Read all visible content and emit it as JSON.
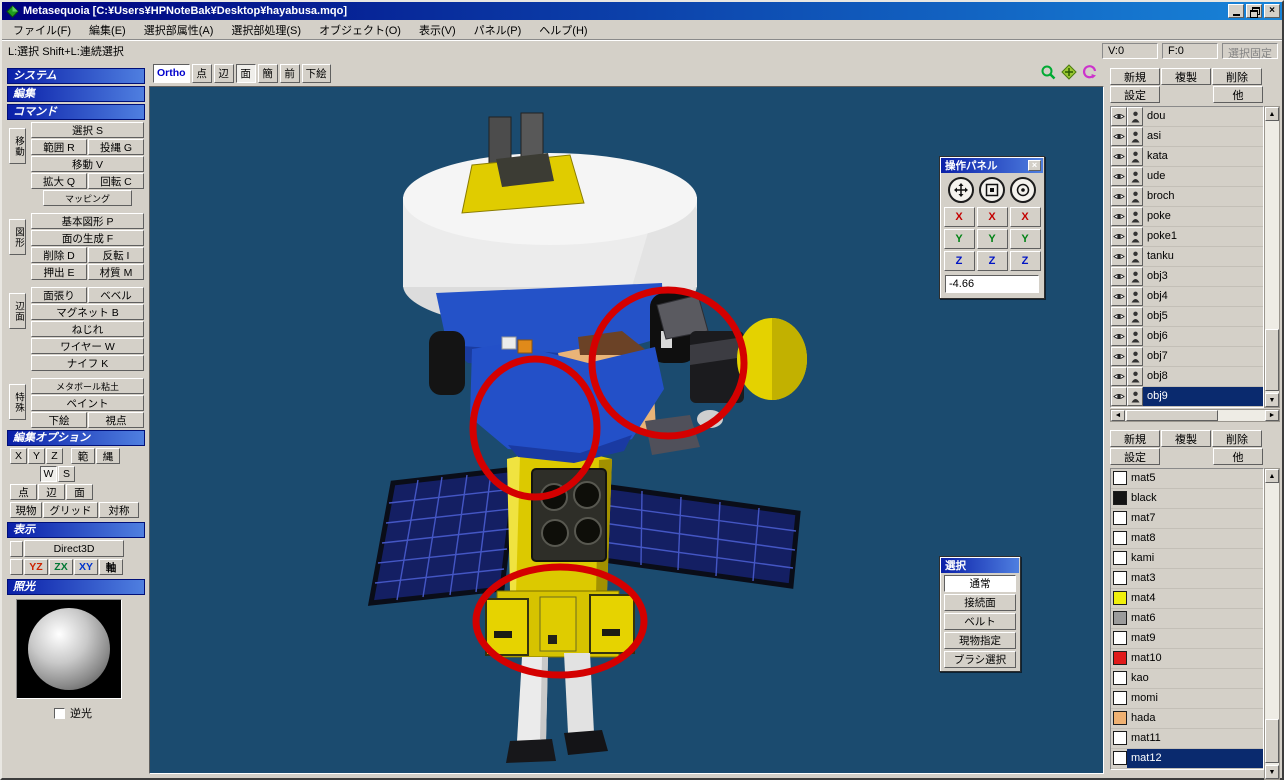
{
  "titlebar": {
    "title": "Metasequoia [C:¥Users¥HPNoteBak¥Desktop¥hayabusa.mqo]"
  },
  "menu": {
    "items": [
      {
        "label": "ファイル(F)"
      },
      {
        "label": "編集(E)"
      },
      {
        "label": "選択部属性(A)"
      },
      {
        "label": "選択部処理(S)"
      },
      {
        "label": "オブジェクト(O)"
      },
      {
        "label": "表示(V)"
      },
      {
        "label": "パネル(P)"
      },
      {
        "label": "ヘルプ(H)"
      }
    ]
  },
  "status": {
    "hint": "L:選択  Shift+L:連続選択",
    "vertices": "V:0",
    "faces": "F:0",
    "fixed": "選択固定"
  },
  "viewport_toolbar": {
    "ortho": "Ortho",
    "point": "点",
    "edge": "辺",
    "face": "面",
    "simple": "簡",
    "front": "前",
    "underlay": "下絵"
  },
  "section_headers": {
    "system": "システム",
    "edit": "編集",
    "command": "コマンド",
    "edit_options": "編集オプション",
    "display": "表示",
    "lighting": "照光"
  },
  "command_tabs": {
    "t1": "移動",
    "t2": "図形",
    "t3": "辺面",
    "t4": "特殊"
  },
  "commands": {
    "select": "選択 S",
    "range": "範囲 R",
    "lasso": "投縄 G",
    "move": "移動 V",
    "scale": "拡大 Q",
    "rotate": "回転 C",
    "mapping": "マッピング",
    "primitive": "基本図形 P",
    "make_face": "面の生成 F",
    "delete": "削除 D",
    "invert": "反転 I",
    "extrude": "押出 E",
    "material": "材質 M",
    "face_fill": "面張り",
    "bevel": "ベベル",
    "magnet": "マグネット B",
    "twist": "ねじれ",
    "wire": "ワイヤー W",
    "knife": "ナイフ K",
    "metaball": "メタボール粘土",
    "paint": "ペイント",
    "underlay": "下絵",
    "viewpoint": "視点"
  },
  "edit_options": {
    "x": "X",
    "y": "Y",
    "z": "Z",
    "range": "範",
    "rope": "縄",
    "w": "W",
    "s": "S",
    "point": "点",
    "edge": "辺",
    "face": "面",
    "actual": "現物",
    "grid": "グリッド",
    "symmetry": "対称"
  },
  "display": {
    "renderer": "Direct3D",
    "yz": "YZ",
    "zx": "ZX",
    "xy": "XY",
    "axis": "軸"
  },
  "lighting": {
    "backlight": "逆光"
  },
  "op_panel": {
    "title": "操作パネル",
    "close": "×",
    "x": "X",
    "y": "Y",
    "z": "Z",
    "value": "-4.66"
  },
  "sel_panel": {
    "title": "選択",
    "buttons": [
      {
        "label": "通常",
        "active": true
      },
      {
        "label": "接続面"
      },
      {
        "label": "ベルト"
      },
      {
        "label": "現物指定"
      },
      {
        "label": "ブラシ選択"
      }
    ]
  },
  "objects": {
    "new": "新規",
    "duplicate": "複製",
    "delete": "削除",
    "settings": "設定",
    "other": "他",
    "items": [
      {
        "name": "dou"
      },
      {
        "name": "asi"
      },
      {
        "name": "kata"
      },
      {
        "name": "ude"
      },
      {
        "name": "broch"
      },
      {
        "name": "poke"
      },
      {
        "name": "poke1"
      },
      {
        "name": "tanku"
      },
      {
        "name": "obj3"
      },
      {
        "name": "obj4"
      },
      {
        "name": "obj5"
      },
      {
        "name": "obj6"
      },
      {
        "name": "obj7"
      },
      {
        "name": "obj8"
      },
      {
        "name": "obj9",
        "selected": true
      }
    ]
  },
  "materials": {
    "new": "新規",
    "duplicate": "複製",
    "delete": "削除",
    "settings": "設定",
    "other": "他",
    "items": [
      {
        "name": "mat5",
        "color": "#ffffff"
      },
      {
        "name": "black",
        "color": "#141414"
      },
      {
        "name": "mat7",
        "color": "#ffffff"
      },
      {
        "name": "mat8",
        "color": "#ffffff"
      },
      {
        "name": "kami",
        "color": "#ffffff"
      },
      {
        "name": "mat3",
        "color": "#ffffff"
      },
      {
        "name": "mat4",
        "color": "#f0ef0c"
      },
      {
        "name": "mat6",
        "color": "#9b9b9b"
      },
      {
        "name": "mat9",
        "color": "#ffffff"
      },
      {
        "name": "mat10",
        "color": "#e01b1b"
      },
      {
        "name": "kao",
        "color": "#ffffff"
      },
      {
        "name": "momi",
        "color": "#ffffff"
      },
      {
        "name": "hada",
        "color": "#efb172"
      },
      {
        "name": "mat11",
        "color": "#ffffff"
      },
      {
        "name": "mat12",
        "color": "#ffffff",
        "selected": true
      }
    ]
  },
  "colors": {
    "viewport_bg": "#1b4b6f",
    "titlebar": "#00007e",
    "annotation": "#d40000",
    "selection_highlight": "#0a2a6e"
  }
}
